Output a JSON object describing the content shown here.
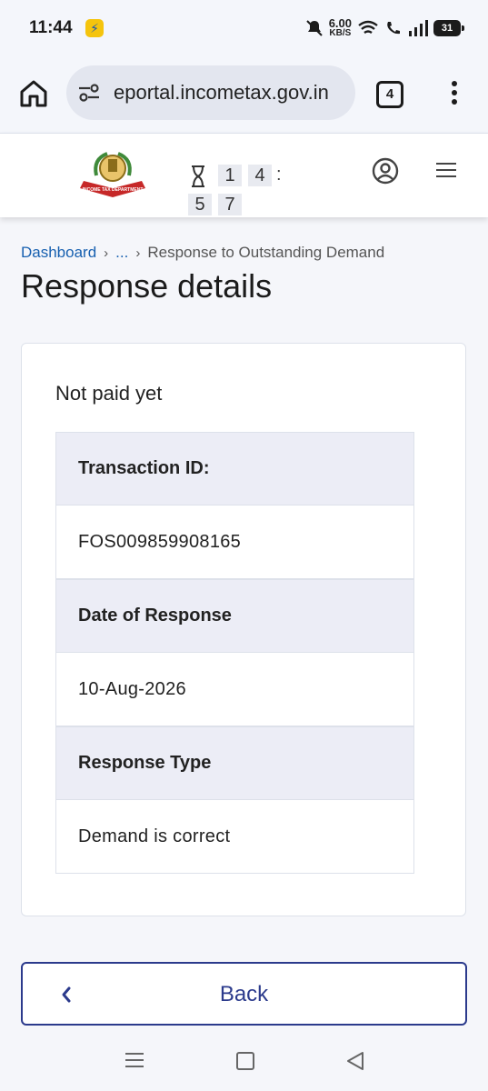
{
  "status_bar": {
    "time": "11:44",
    "net_speed": "6.00",
    "net_unit": "KB/S",
    "battery": "31"
  },
  "browser": {
    "url": "eportal.incometax.gov.in",
    "tab_count": "4"
  },
  "header": {
    "logo_alt": "INCOME TAX DEPARTMENT",
    "timer_digits": [
      "1",
      "4",
      "5",
      "7"
    ],
    "timer_separator": ":"
  },
  "breadcrumb": {
    "home": "Dashboard",
    "ellipsis": "...",
    "current": "Response to Outstanding Demand",
    "separator": "›"
  },
  "page": {
    "title": "Response details",
    "status": "Not paid yet"
  },
  "details": [
    {
      "label": "Transaction ID:",
      "value": "FOS009859908165"
    },
    {
      "label": "Date of Response",
      "value": "10-Aug-2026"
    },
    {
      "label": "Response Type",
      "value": "Demand is correct"
    }
  ],
  "actions": {
    "back_label": "Back"
  },
  "colors": {
    "accent": "#2b3a8c",
    "link": "#1760b0",
    "label_bg": "#ecedf6"
  }
}
